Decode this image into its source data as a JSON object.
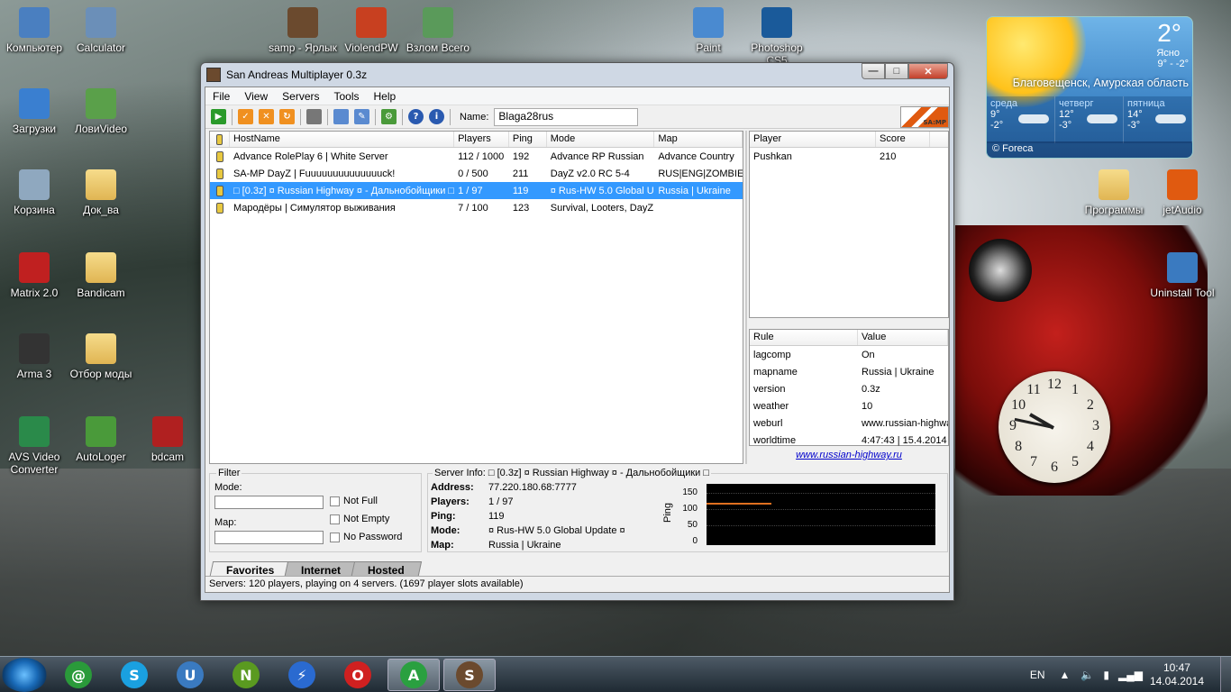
{
  "desktop": {
    "icons_left": [
      {
        "label": "Компьютер",
        "icon": "computer-icon",
        "color": "#4a7fc0"
      },
      {
        "label": "Calculator",
        "icon": "calculator-icon",
        "color": "#6b8fb8"
      },
      {
        "label": "Загрузки",
        "icon": "downloads-icon",
        "color": "#3a7fd0"
      },
      {
        "label": "ЛовиVideo",
        "icon": "lovivideo-icon",
        "color": "#5aa04a"
      },
      {
        "label": "Корзина",
        "icon": "recycle-bin-icon",
        "color": "#8fa8bf"
      },
      {
        "label": "Док_ва",
        "icon": "folder-icon",
        "color": "#e0b553"
      },
      {
        "label": "Matrix 2.0",
        "icon": "matrix-icon",
        "color": "#c02020"
      },
      {
        "label": "Bandicam",
        "icon": "folder-icon",
        "color": "#e0b553"
      },
      {
        "label": "Arma 3",
        "icon": "arma-icon",
        "color": "#333333"
      },
      {
        "label": "Отбор моды",
        "icon": "folder-icon",
        "color": "#e0b553"
      },
      {
        "label": "AVS Video Converter",
        "icon": "avs-icon",
        "color": "#2a8a4a"
      },
      {
        "label": "AutoLoger",
        "icon": "autologer-icon",
        "color": "#4a9a3a"
      },
      {
        "label": "bdcam",
        "icon": "bdcam-icon",
        "color": "#b02020"
      }
    ],
    "icons_top": [
      {
        "label": "samp - Ярлык",
        "icon": "samp-icon",
        "color": "#6b4a2e"
      },
      {
        "label": "ViolendPW",
        "icon": "violendpw-icon",
        "color": "#c84020"
      },
      {
        "label": "Взлом Всего",
        "icon": "hack-icon",
        "color": "#5a9a5a"
      },
      {
        "label": "Paint",
        "icon": "paint-icon",
        "color": "#4a8ad0"
      },
      {
        "label": "Photoshop CS5",
        "icon": "photoshop-icon",
        "color": "#1a5a9a"
      }
    ],
    "icons_right": [
      {
        "label": "Программы",
        "icon": "folder-icon",
        "color": "#e0b553"
      },
      {
        "label": "jetAudio",
        "icon": "jetaudio-icon",
        "color": "#e05a10"
      },
      {
        "label": "Uninstall Tool",
        "icon": "uninstall-icon",
        "color": "#3a7ac0"
      }
    ]
  },
  "weather": {
    "temp": "2°",
    "condition": "Ясно",
    "range": "9° - -2°",
    "city": "Благовещенск, Амурская область",
    "days": [
      {
        "name": "среда",
        "hi": "9°",
        "lo": "-2°"
      },
      {
        "name": "четверг",
        "hi": "12°",
        "lo": "-3°"
      },
      {
        "name": "пятница",
        "hi": "14°",
        "lo": "-3°"
      }
    ],
    "provider": "© Foreca"
  },
  "clock_numbers": [
    "12",
    "1",
    "2",
    "3",
    "4",
    "5",
    "6",
    "7",
    "8",
    "9",
    "10",
    "11"
  ],
  "window": {
    "title": "San Andreas Multiplayer 0.3z",
    "min": "—",
    "max": "□",
    "close": "✕",
    "menu": [
      "File",
      "View",
      "Servers",
      "Tools",
      "Help"
    ],
    "name_label": "Name:",
    "name_value": "Blaga28rus",
    "logo_text": "SA:MP",
    "columns": [
      "HostName",
      "Players",
      "Ping",
      "Mode",
      "Map"
    ],
    "servers": [
      {
        "host": "Advance RolePlay 6 | White Server",
        "players": "112 / 1000",
        "ping": "192",
        "mode": "Advance RP Russian",
        "map": "Advance Country",
        "selected": false
      },
      {
        "host": "SA-MP DayZ | Fuuuuuuuuuuuuuuck!",
        "players": "0 / 500",
        "ping": "211",
        "mode": "DayZ v2.0 RC 5-4",
        "map": "RUS|ENG|ZOMBIE",
        "selected": false
      },
      {
        "host": "□ [0.3z] ¤ Russian Highway ¤ - Дальнобойщики □",
        "players": "1 / 97",
        "ping": "119",
        "mode": "¤ Rus-HW 5.0 Global Update ¤",
        "map": "Russia | Ukraine",
        "selected": true
      },
      {
        "host": "Мародёры | Симулятор выживания",
        "players": "7 / 100",
        "ping": "123",
        "mode": "Survival, Looters, DayZ, LS/SF/LV",
        "map": "",
        "selected": false
      }
    ],
    "player_columns": [
      "Player",
      "Score"
    ],
    "players": [
      {
        "name": "Pushkan",
        "score": "210"
      }
    ],
    "rule_columns": [
      "Rule",
      "Value"
    ],
    "rules": [
      {
        "rule": "lagcomp",
        "value": "On"
      },
      {
        "rule": "mapname",
        "value": "Russia | Ukraine"
      },
      {
        "rule": "version",
        "value": "0.3z"
      },
      {
        "rule": "weather",
        "value": "10"
      },
      {
        "rule": "weburl",
        "value": "www.russian-highway.ru"
      },
      {
        "rule": "worldtime",
        "value": "4:47:43 | 15.4.2014"
      }
    ],
    "server_url": "www.russian-highway.ru",
    "filter": {
      "title": "Filter",
      "mode_label": "Mode:",
      "map_label": "Map:",
      "mode_value": "",
      "map_value": "",
      "not_full": "Not Full",
      "not_empty": "Not Empty",
      "no_password": "No Password"
    },
    "info": {
      "title": "Server Info: □ [0.3z] ¤ Russian Highway ¤ - Дальнобойщики □",
      "address_label": "Address:",
      "address": "77.220.180.68:7777",
      "players_label": "Players:",
      "players": "1 / 97",
      "ping_label": "Ping:",
      "ping": "119",
      "mode_label": "Mode:",
      "mode": "¤ Rus-HW 5.0 Global Update ¤",
      "map_label": "Map:",
      "map": "Russia | Ukraine",
      "graph_axis_label": "Ping",
      "graph_ticks": [
        "150",
        "100",
        "50",
        "0"
      ],
      "graph_color": "#e07020"
    },
    "tabs": [
      "Favorites",
      "Internet",
      "Hosted"
    ],
    "active_tab": "Favorites",
    "status": "Servers: 120 players, playing on 4 servers. (1697 player slots available)"
  },
  "taskbar": {
    "apps": [
      {
        "name": "mail-agent-icon",
        "color": "#2a9a3a",
        "glyph": "@"
      },
      {
        "name": "skype-icon",
        "color": "#1aa0e0",
        "glyph": "S"
      },
      {
        "name": "uninstall-tool-icon",
        "color": "#3a7ac0",
        "glyph": "U"
      },
      {
        "name": "nvidia-icon",
        "color": "#5a9a20",
        "glyph": "N"
      },
      {
        "name": "quick-launch-icon",
        "color": "#2a6ad0",
        "glyph": "⚡"
      },
      {
        "name": "opera-icon",
        "color": "#d02020",
        "glyph": "O"
      },
      {
        "name": "autologer-icon",
        "color": "#2aa040",
        "glyph": "A"
      },
      {
        "name": "samp-icon",
        "color": "#6b4a2e",
        "glyph": "S"
      }
    ],
    "lang": "EN",
    "time": "10:47",
    "date": "14.04.2014"
  }
}
